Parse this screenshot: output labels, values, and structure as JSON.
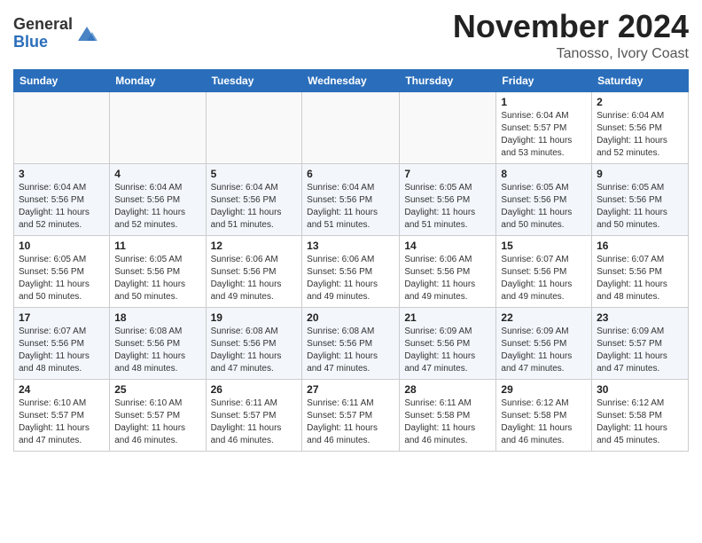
{
  "logo": {
    "general": "General",
    "blue": "Blue"
  },
  "header": {
    "month": "November 2024",
    "location": "Tanosso, Ivory Coast"
  },
  "weekdays": [
    "Sunday",
    "Monday",
    "Tuesday",
    "Wednesday",
    "Thursday",
    "Friday",
    "Saturday"
  ],
  "weeks": [
    [
      {
        "day": "",
        "info": ""
      },
      {
        "day": "",
        "info": ""
      },
      {
        "day": "",
        "info": ""
      },
      {
        "day": "",
        "info": ""
      },
      {
        "day": "",
        "info": ""
      },
      {
        "day": "1",
        "info": "Sunrise: 6:04 AM\nSunset: 5:57 PM\nDaylight: 11 hours\nand 53 minutes."
      },
      {
        "day": "2",
        "info": "Sunrise: 6:04 AM\nSunset: 5:56 PM\nDaylight: 11 hours\nand 52 minutes."
      }
    ],
    [
      {
        "day": "3",
        "info": "Sunrise: 6:04 AM\nSunset: 5:56 PM\nDaylight: 11 hours\nand 52 minutes."
      },
      {
        "day": "4",
        "info": "Sunrise: 6:04 AM\nSunset: 5:56 PM\nDaylight: 11 hours\nand 52 minutes."
      },
      {
        "day": "5",
        "info": "Sunrise: 6:04 AM\nSunset: 5:56 PM\nDaylight: 11 hours\nand 51 minutes."
      },
      {
        "day": "6",
        "info": "Sunrise: 6:04 AM\nSunset: 5:56 PM\nDaylight: 11 hours\nand 51 minutes."
      },
      {
        "day": "7",
        "info": "Sunrise: 6:05 AM\nSunset: 5:56 PM\nDaylight: 11 hours\nand 51 minutes."
      },
      {
        "day": "8",
        "info": "Sunrise: 6:05 AM\nSunset: 5:56 PM\nDaylight: 11 hours\nand 50 minutes."
      },
      {
        "day": "9",
        "info": "Sunrise: 6:05 AM\nSunset: 5:56 PM\nDaylight: 11 hours\nand 50 minutes."
      }
    ],
    [
      {
        "day": "10",
        "info": "Sunrise: 6:05 AM\nSunset: 5:56 PM\nDaylight: 11 hours\nand 50 minutes."
      },
      {
        "day": "11",
        "info": "Sunrise: 6:05 AM\nSunset: 5:56 PM\nDaylight: 11 hours\nand 50 minutes."
      },
      {
        "day": "12",
        "info": "Sunrise: 6:06 AM\nSunset: 5:56 PM\nDaylight: 11 hours\nand 49 minutes."
      },
      {
        "day": "13",
        "info": "Sunrise: 6:06 AM\nSunset: 5:56 PM\nDaylight: 11 hours\nand 49 minutes."
      },
      {
        "day": "14",
        "info": "Sunrise: 6:06 AM\nSunset: 5:56 PM\nDaylight: 11 hours\nand 49 minutes."
      },
      {
        "day": "15",
        "info": "Sunrise: 6:07 AM\nSunset: 5:56 PM\nDaylight: 11 hours\nand 49 minutes."
      },
      {
        "day": "16",
        "info": "Sunrise: 6:07 AM\nSunset: 5:56 PM\nDaylight: 11 hours\nand 48 minutes."
      }
    ],
    [
      {
        "day": "17",
        "info": "Sunrise: 6:07 AM\nSunset: 5:56 PM\nDaylight: 11 hours\nand 48 minutes."
      },
      {
        "day": "18",
        "info": "Sunrise: 6:08 AM\nSunset: 5:56 PM\nDaylight: 11 hours\nand 48 minutes."
      },
      {
        "day": "19",
        "info": "Sunrise: 6:08 AM\nSunset: 5:56 PM\nDaylight: 11 hours\nand 47 minutes."
      },
      {
        "day": "20",
        "info": "Sunrise: 6:08 AM\nSunset: 5:56 PM\nDaylight: 11 hours\nand 47 minutes."
      },
      {
        "day": "21",
        "info": "Sunrise: 6:09 AM\nSunset: 5:56 PM\nDaylight: 11 hours\nand 47 minutes."
      },
      {
        "day": "22",
        "info": "Sunrise: 6:09 AM\nSunset: 5:56 PM\nDaylight: 11 hours\nand 47 minutes."
      },
      {
        "day": "23",
        "info": "Sunrise: 6:09 AM\nSunset: 5:57 PM\nDaylight: 11 hours\nand 47 minutes."
      }
    ],
    [
      {
        "day": "24",
        "info": "Sunrise: 6:10 AM\nSunset: 5:57 PM\nDaylight: 11 hours\nand 47 minutes."
      },
      {
        "day": "25",
        "info": "Sunrise: 6:10 AM\nSunset: 5:57 PM\nDaylight: 11 hours\nand 46 minutes."
      },
      {
        "day": "26",
        "info": "Sunrise: 6:11 AM\nSunset: 5:57 PM\nDaylight: 11 hours\nand 46 minutes."
      },
      {
        "day": "27",
        "info": "Sunrise: 6:11 AM\nSunset: 5:57 PM\nDaylight: 11 hours\nand 46 minutes."
      },
      {
        "day": "28",
        "info": "Sunrise: 6:11 AM\nSunset: 5:58 PM\nDaylight: 11 hours\nand 46 minutes."
      },
      {
        "day": "29",
        "info": "Sunrise: 6:12 AM\nSunset: 5:58 PM\nDaylight: 11 hours\nand 46 minutes."
      },
      {
        "day": "30",
        "info": "Sunrise: 6:12 AM\nSunset: 5:58 PM\nDaylight: 11 hours\nand 45 minutes."
      }
    ]
  ]
}
